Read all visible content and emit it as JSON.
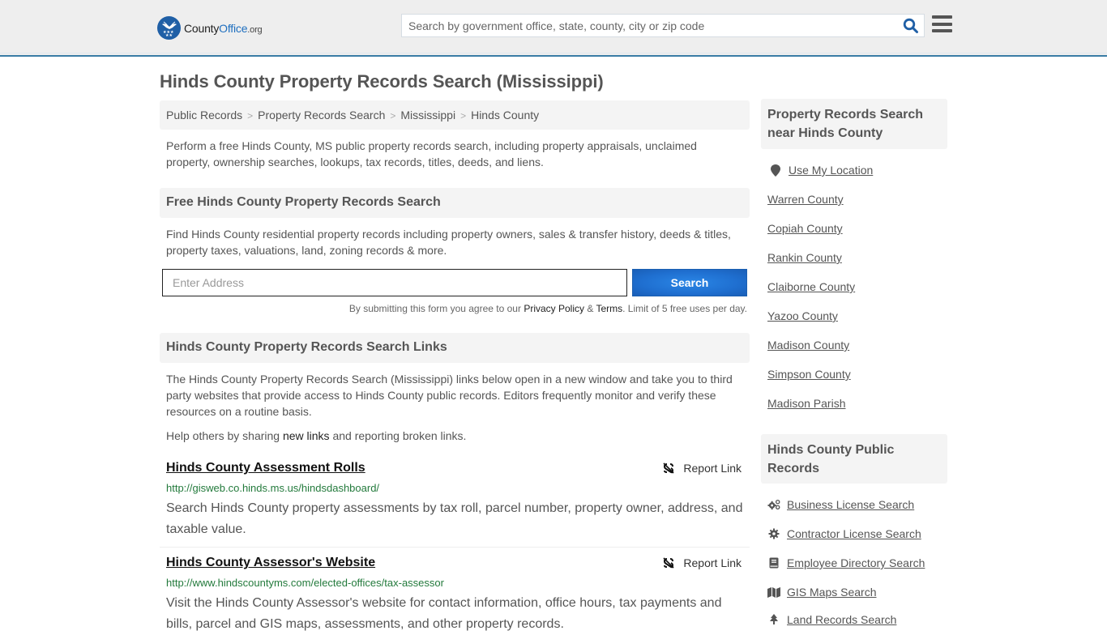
{
  "header": {
    "logo": {
      "name_part1": "County",
      "name_part2": "Office",
      "tld": ".org"
    },
    "search": {
      "placeholder": "Search by government office, state, county, city or zip code",
      "value": ""
    },
    "icons": {
      "search": "search-icon",
      "menu": "hamburger-menu-icon"
    }
  },
  "page": {
    "title": "Hinds County Property Records Search (Mississippi)",
    "breadcrumb": [
      {
        "label": "Public Records"
      },
      {
        "label": "Property Records Search"
      },
      {
        "label": "Mississippi"
      },
      {
        "label": "Hinds County"
      }
    ],
    "breadcrumb_separator": ">",
    "intro": "Perform a free Hinds County, MS public property records search, including property appraisals, unclaimed property, ownership searches, lookups, tax records, titles, deeds, and liens."
  },
  "free_search": {
    "heading": "Free Hinds County Property Records Search",
    "description": "Find Hinds County residential property records including property owners, sales & transfer history, deeds & titles, property taxes, valuations, land, zoning records & more.",
    "address_placeholder": "Enter Address",
    "address_value": "",
    "button_label": "Search",
    "terms_prefix": "By submitting this form you agree to our ",
    "privacy_label": "Privacy Policy",
    "terms_and": " & ",
    "terms_label": "Terms",
    "terms_suffix": ". Limit of 5 free uses per day."
  },
  "links_section": {
    "heading": "Hinds County Property Records Search Links",
    "description": "The Hinds County Property Records Search (Mississippi) links below open in a new window and take you to third party websites that provide access to Hinds County public records. Editors frequently monitor and verify these resources on a routine basis.",
    "help_prefix": "Help others by sharing ",
    "help_link": "new links",
    "help_suffix": " and reporting broken links.",
    "report_label": "Report Link",
    "entries": [
      {
        "title": "Hinds County Assessment Rolls",
        "url": "http://gisweb.co.hinds.ms.us/hindsdashboard/",
        "description": "Search Hinds County property assessments by tax roll, parcel number, property owner, address, and taxable value."
      },
      {
        "title": "Hinds County Assessor's Website",
        "url": "http://www.hindscountyms.com/elected-offices/tax-assessor",
        "description": "Visit the Hinds County Assessor's website for contact information, office hours, tax payments and bills, parcel and GIS maps, assessments, and other property records."
      }
    ]
  },
  "sidebar": {
    "nearby": {
      "heading": "Property Records Search near Hinds County",
      "use_location": "Use My Location",
      "items": [
        {
          "label": "Warren County"
        },
        {
          "label": "Copiah County"
        },
        {
          "label": "Rankin County"
        },
        {
          "label": "Claiborne County"
        },
        {
          "label": "Yazoo County"
        },
        {
          "label": "Madison County"
        },
        {
          "label": "Simpson County"
        },
        {
          "label": "Madison Parish"
        }
      ]
    },
    "public_records": {
      "heading": "Hinds County Public Records",
      "items": [
        {
          "label": "Business License Search",
          "icon": "cogs-icon"
        },
        {
          "label": "Contractor License Search",
          "icon": "gear-icon"
        },
        {
          "label": "Employee Directory Search",
          "icon": "book-icon"
        },
        {
          "label": "GIS Maps Search",
          "icon": "map-icon"
        },
        {
          "label": "Land Records Search",
          "icon": "tree-icon"
        }
      ]
    }
  },
  "colors": {
    "accent_blue": "#1f6fd0",
    "header_border": "#3a7ca5",
    "url_green": "#237a3c",
    "panel_gray": "#f4f4f4"
  }
}
